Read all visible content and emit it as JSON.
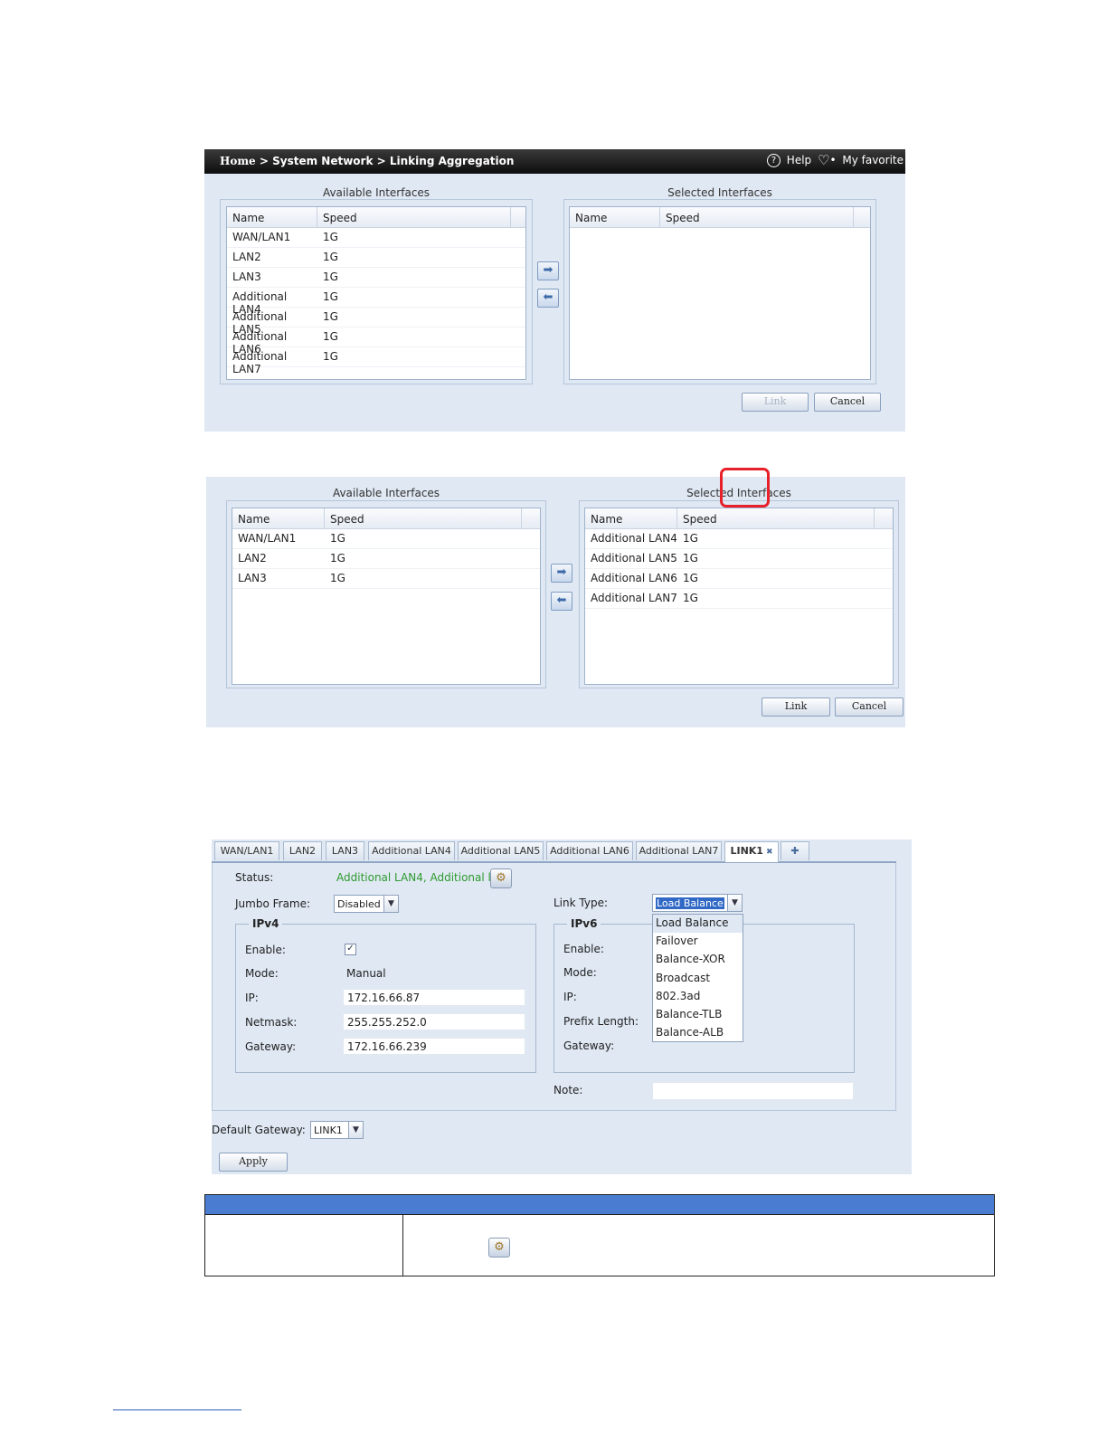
{
  "panel1": {
    "breadcrumb": {
      "home": "Home",
      "sep1": ">",
      "section": "System Network",
      "sep2": ">",
      "page": "Linking Aggregation"
    },
    "help_icon": "question-circle-icon",
    "help_label": "Help",
    "favorite_icon": "heart-icon",
    "favorite_label": "My favorite",
    "available_title": "Available Interfaces",
    "selected_title": "Selected Interfaces",
    "columns": [
      "Name",
      "Speed"
    ],
    "available_rows": [
      {
        "name": "WAN/LAN1",
        "speed": "1G"
      },
      {
        "name": "LAN2",
        "speed": "1G"
      },
      {
        "name": "LAN3",
        "speed": "1G"
      },
      {
        "name": "Additional LAN4",
        "speed": "1G"
      },
      {
        "name": "Additional LAN5",
        "speed": "1G"
      },
      {
        "name": "Additional LAN6",
        "speed": "1G"
      },
      {
        "name": "Additional LAN7",
        "speed": "1G"
      }
    ],
    "selected_rows": [],
    "link_label": "Link",
    "link_disabled": true,
    "cancel_label": "Cancel"
  },
  "panel2": {
    "available_title": "Available Interfaces",
    "selected_title": "Selected Interfaces",
    "columns": [
      "Name",
      "Speed"
    ],
    "available_rows": [
      {
        "name": "WAN/LAN1",
        "speed": "1G"
      },
      {
        "name": "LAN2",
        "speed": "1G"
      },
      {
        "name": "LAN3",
        "speed": "1G"
      }
    ],
    "selected_rows": [
      {
        "name": "Additional LAN4",
        "speed": "1G"
      },
      {
        "name": "Additional LAN5",
        "speed": "1G"
      },
      {
        "name": "Additional LAN6",
        "speed": "1G"
      },
      {
        "name": "Additional LAN7",
        "speed": "1G"
      }
    ],
    "link_label": "Link",
    "cancel_label": "Cancel",
    "highlight_color": "#e8202a"
  },
  "panel3": {
    "tabs": [
      "WAN/LAN1",
      "LAN2",
      "LAN3",
      "Additional LAN4",
      "Additional LAN5",
      "Additional LAN6",
      "Additional LAN7",
      "LINK1"
    ],
    "active_tab": "LINK1",
    "add_tab_icon": "plus-icon",
    "status_label": "Status:",
    "status_value": "Additional LAN4, Additional l",
    "status_color": "#2f9a2f",
    "jumbo_label": "Jumbo Frame:",
    "jumbo_value": "Disabled",
    "link_type_label": "Link Type:",
    "link_type_value": "Load Balance",
    "link_type_options": [
      "Load Balance",
      "Failover",
      "Balance-XOR",
      "Broadcast",
      "802.3ad",
      "Balance-TLB",
      "Balance-ALB"
    ],
    "ipv4": {
      "legend": "IPv4",
      "enable_label": "Enable:",
      "enabled": true,
      "mode_label": "Mode:",
      "mode_value": "Manual",
      "ip_label": "IP:",
      "ip_value": "172.16.66.87",
      "netmask_label": "Netmask:",
      "netmask_value": "255.255.252.0",
      "gateway_label": "Gateway:",
      "gateway_value": "172.16.66.239"
    },
    "ipv6": {
      "legend": "IPv6",
      "enable_label": "Enable:",
      "mode_label": "Mode:",
      "ip_label": "IP:",
      "prefix_label": "Prefix Length:",
      "gateway_label": "Gateway:"
    },
    "note_label": "Note:",
    "note_value": "",
    "default_gateway_label": "Default Gateway:",
    "default_gateway_value": "LINK1",
    "apply_label": "Apply"
  },
  "table": {
    "header_color": "#4a7dd1",
    "config_icon": "gear-config-icon"
  }
}
